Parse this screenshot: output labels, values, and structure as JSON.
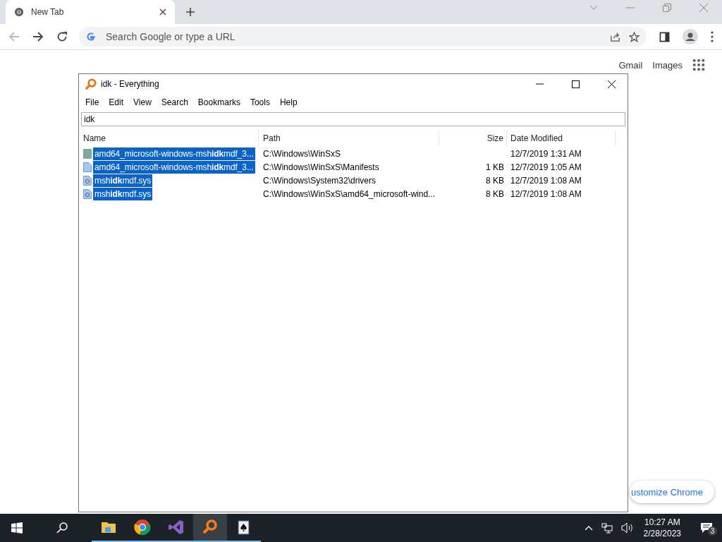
{
  "browser": {
    "tab": {
      "title": "New Tab",
      "selected": true
    },
    "omnibox": {
      "placeholder": "Search Google or type a URL"
    },
    "page": {
      "links": [
        "Gmail",
        "Images"
      ],
      "customize_button": "ustomize Chrome"
    }
  },
  "window": {
    "title": "idk - Everything",
    "menu": [
      "File",
      "Edit",
      "View",
      "Search",
      "Bookmarks",
      "Tools",
      "Help"
    ],
    "search": {
      "value": "idk"
    },
    "table": {
      "columns": [
        "Name",
        "Path",
        "Size",
        "Date Modified"
      ],
      "rows": [
        {
          "kind": "folder",
          "selected": true,
          "name": "amd64_microsoft-windows-msh**idk**mdf_3...",
          "path": "C:\\Windows\\WinSxS",
          "size": "",
          "date": "12/7/2019 1:31 AM"
        },
        {
          "kind": "file",
          "selected": true,
          "name": "amd64_microsoft-windows-msh**idk**mdf_3...",
          "path": "C:\\Windows\\WinSxS\\Manifests",
          "size": "1 KB",
          "date": "12/7/2019 1:05 AM"
        },
        {
          "kind": "system",
          "selected": true,
          "name": "msh**idk**mdf.sys",
          "path": "C:\\Windows\\System32\\drivers",
          "size": "8 KB",
          "date": "12/7/2019 1:08 AM"
        },
        {
          "kind": "system",
          "selected": true,
          "name": "msh**idk**mdf.sys",
          "path": "C:\\Windows\\WinSxS\\amd64_microsoft-wind...",
          "size": "8 KB",
          "date": "12/7/2019 1:08 AM"
        }
      ]
    }
  },
  "taskbar": {
    "apps": [
      {
        "kind": "folder",
        "active": false
      },
      {
        "kind": "chrome",
        "active": false
      },
      {
        "kind": "studio",
        "active": false
      },
      {
        "kind": "search",
        "active": true
      },
      {
        "kind": "cards",
        "active": false
      }
    ],
    "time": "10:27 AM",
    "date": "2/28/2023",
    "notifications": "3"
  }
}
